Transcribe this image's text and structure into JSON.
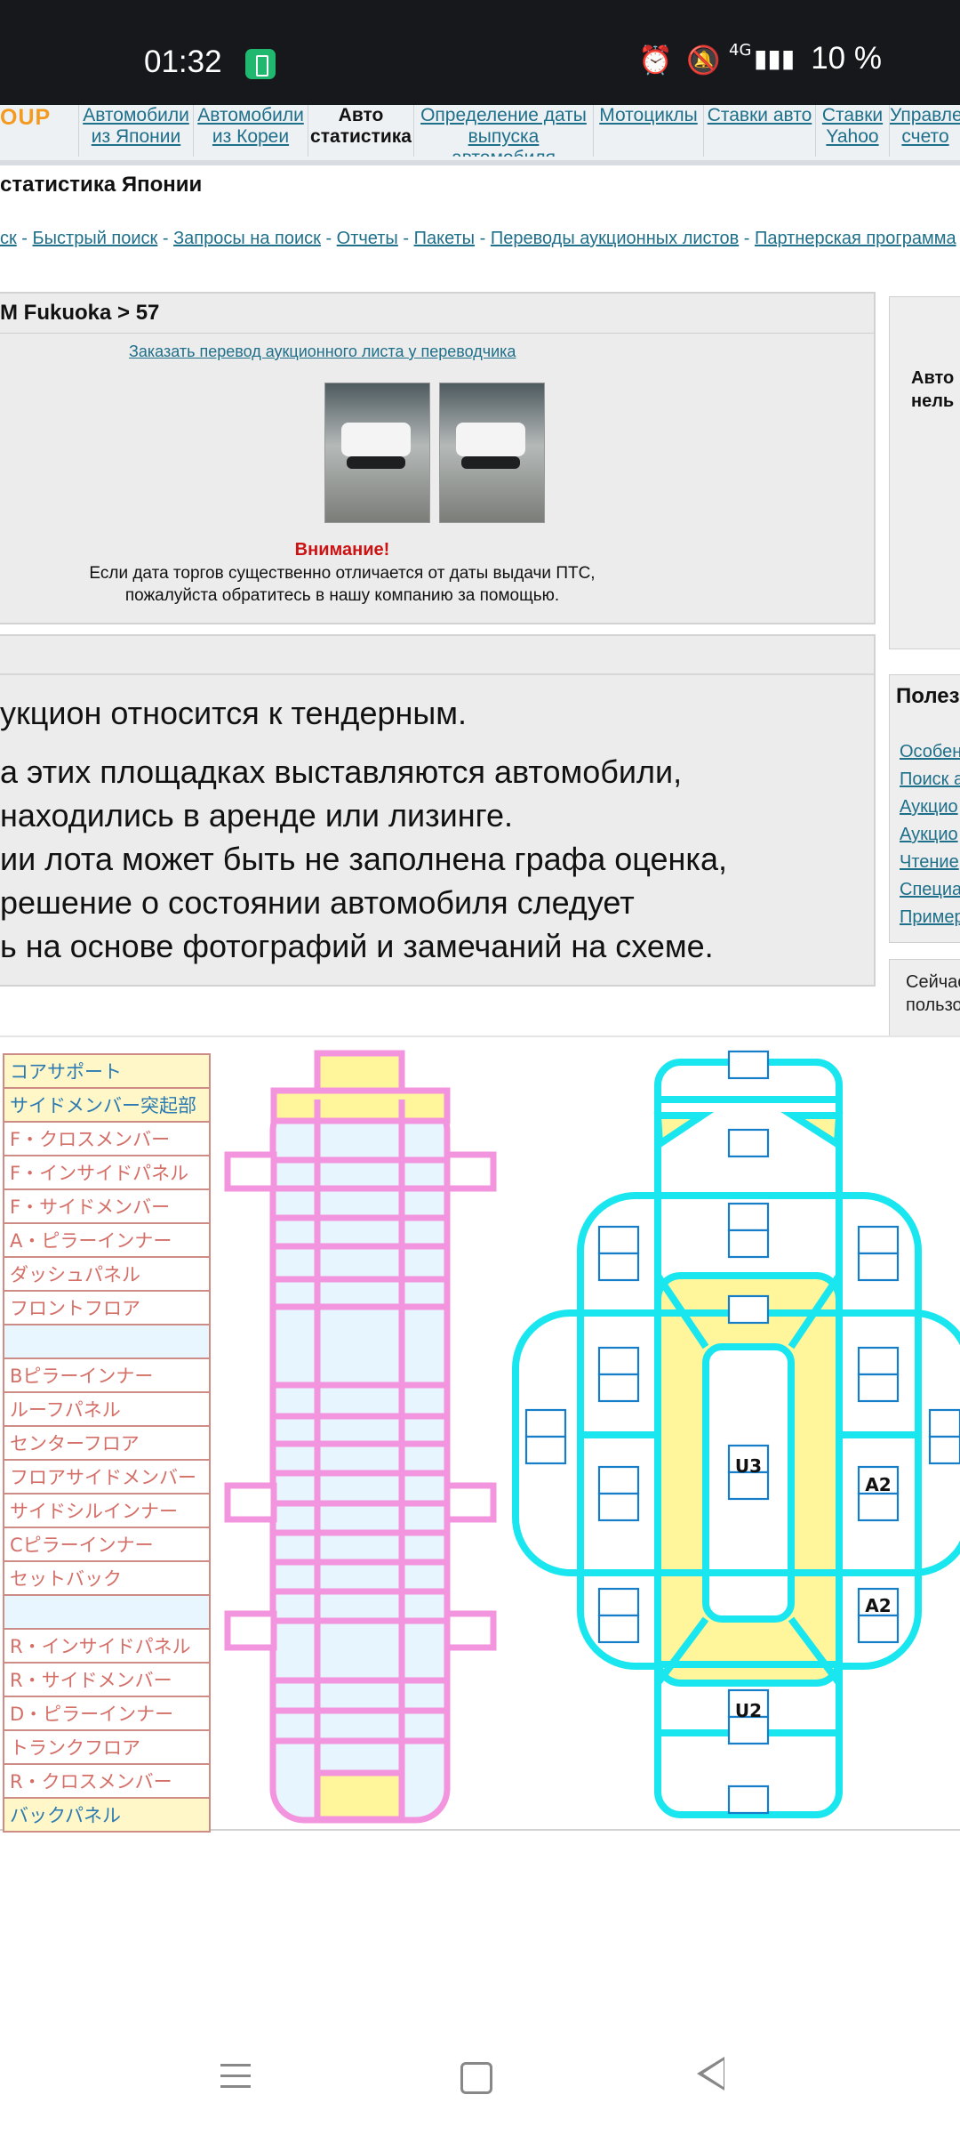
{
  "status_bar": {
    "time": "01:32",
    "network": "4G",
    "battery": "10 %"
  },
  "site": {
    "logo": "OUP",
    "nav": [
      {
        "label": "Автомобили из Японии"
      },
      {
        "label": "Автомобили из Кореи"
      },
      {
        "label": "Авто статистика"
      },
      {
        "label": "Определение даты выпуска автомобиля"
      },
      {
        "label": "Мотоциклы"
      },
      {
        "label": "Ставки авто"
      },
      {
        "label": "Ставки Yahoo"
      },
      {
        "label": "Управле счето"
      }
    ],
    "page_title": "статистика Японии",
    "sublinks": [
      "ск",
      "Быстрый поиск",
      "Запросы на поиск",
      "Отчеты",
      "Пакеты",
      "Переводы аукционных листов",
      "Партнерская программа"
    ]
  },
  "lot_panel": {
    "title": "M Fukuoka > 57",
    "translate_link": "Заказать перевод аукционного листа у переводчика",
    "attention": "Внимание!",
    "attention_line1": "Если дата торгов существенно отличается от даты выдачи ПТС,",
    "attention_line2": "пожалуйста обратитесь в нашу компанию за помощью."
  },
  "info": {
    "lines": [
      "укцион относится к тендерным.",
      "а этих площадках выставляются автомобили,",
      "находились в аренде или лизинге.",
      "ии лота может быть не заполнена графа оценка,",
      "решение о состоянии автомобиля следует",
      "ь на основе фотографий и замечаний на схеме."
    ]
  },
  "sidebar": {
    "auction_line1": "Авто",
    "auction_line2": "нель",
    "useful_title": "Полез",
    "useful_links": [
      "Особен",
      "Поиск а",
      "Аукцио",
      "Аукцио",
      "Чтение",
      "Специа",
      "Пример"
    ],
    "online_line1": "Сейчас",
    "online_line2": "пользо"
  },
  "parts": [
    {
      "label": "コアサポート",
      "highlight": true
    },
    {
      "label": "サイドメンバー突起部",
      "highlight": true
    },
    {
      "label": "F・クロスメンバー"
    },
    {
      "label": "F・インサイドパネル"
    },
    {
      "label": "F・サイドメンバー"
    },
    {
      "label": "A・ピラーインナー"
    },
    {
      "label": "ダッシュパネル"
    },
    {
      "label": "フロントフロア"
    },
    {
      "label": ""
    },
    {
      "label": "Bピラーインナー"
    },
    {
      "label": "ルーフパネル"
    },
    {
      "label": "センターフロア"
    },
    {
      "label": "フロアサイドメンバー"
    },
    {
      "label": "サイドシルインナー"
    },
    {
      "label": "Cピラーインナー"
    },
    {
      "label": "セットバック"
    },
    {
      "label": ""
    },
    {
      "label": "R・インサイドパネル"
    },
    {
      "label": "R・サイドメンバー"
    },
    {
      "label": "D・ピラーインナー"
    },
    {
      "label": "トランクフロア"
    },
    {
      "label": "R・クロスメンバー"
    },
    {
      "label": "バックパネル",
      "highlight": true
    }
  ],
  "damage_codes": {
    "center": "U3",
    "right_top": "A2",
    "right_bottom": "A2",
    "rear": "U2"
  },
  "colors": {
    "frame_pink": "#f294de",
    "body_cyan": "#19e6ef",
    "panel_yellow": "#fff59a",
    "link_blue": "#1e6f8a",
    "attention_red": "#cc1212"
  }
}
